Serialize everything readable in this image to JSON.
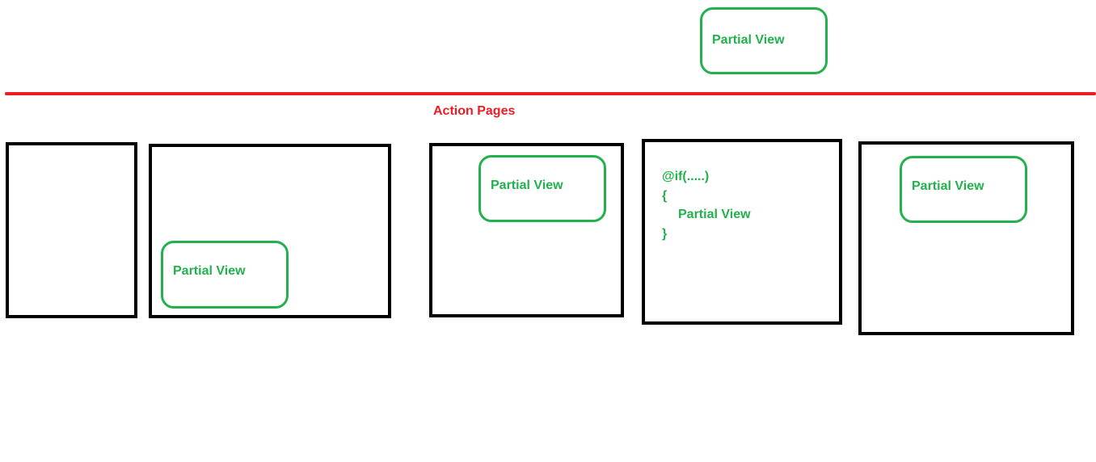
{
  "top_partial": {
    "label": "Partial View"
  },
  "divider_label": "Action Pages",
  "pages": [
    {
      "partial_label": null
    },
    {
      "partial_label": "Partial View"
    },
    {
      "partial_label": "Partial View"
    },
    {
      "code": {
        "if_line": "@if(.....)",
        "open_brace": "{",
        "partial_label": "Partial View",
        "close_brace": "}"
      }
    },
    {
      "partial_label": "Partial View"
    }
  ],
  "colors": {
    "partial_border": "#22b14c",
    "page_border": "#000000",
    "divider": "#ed1c24"
  }
}
